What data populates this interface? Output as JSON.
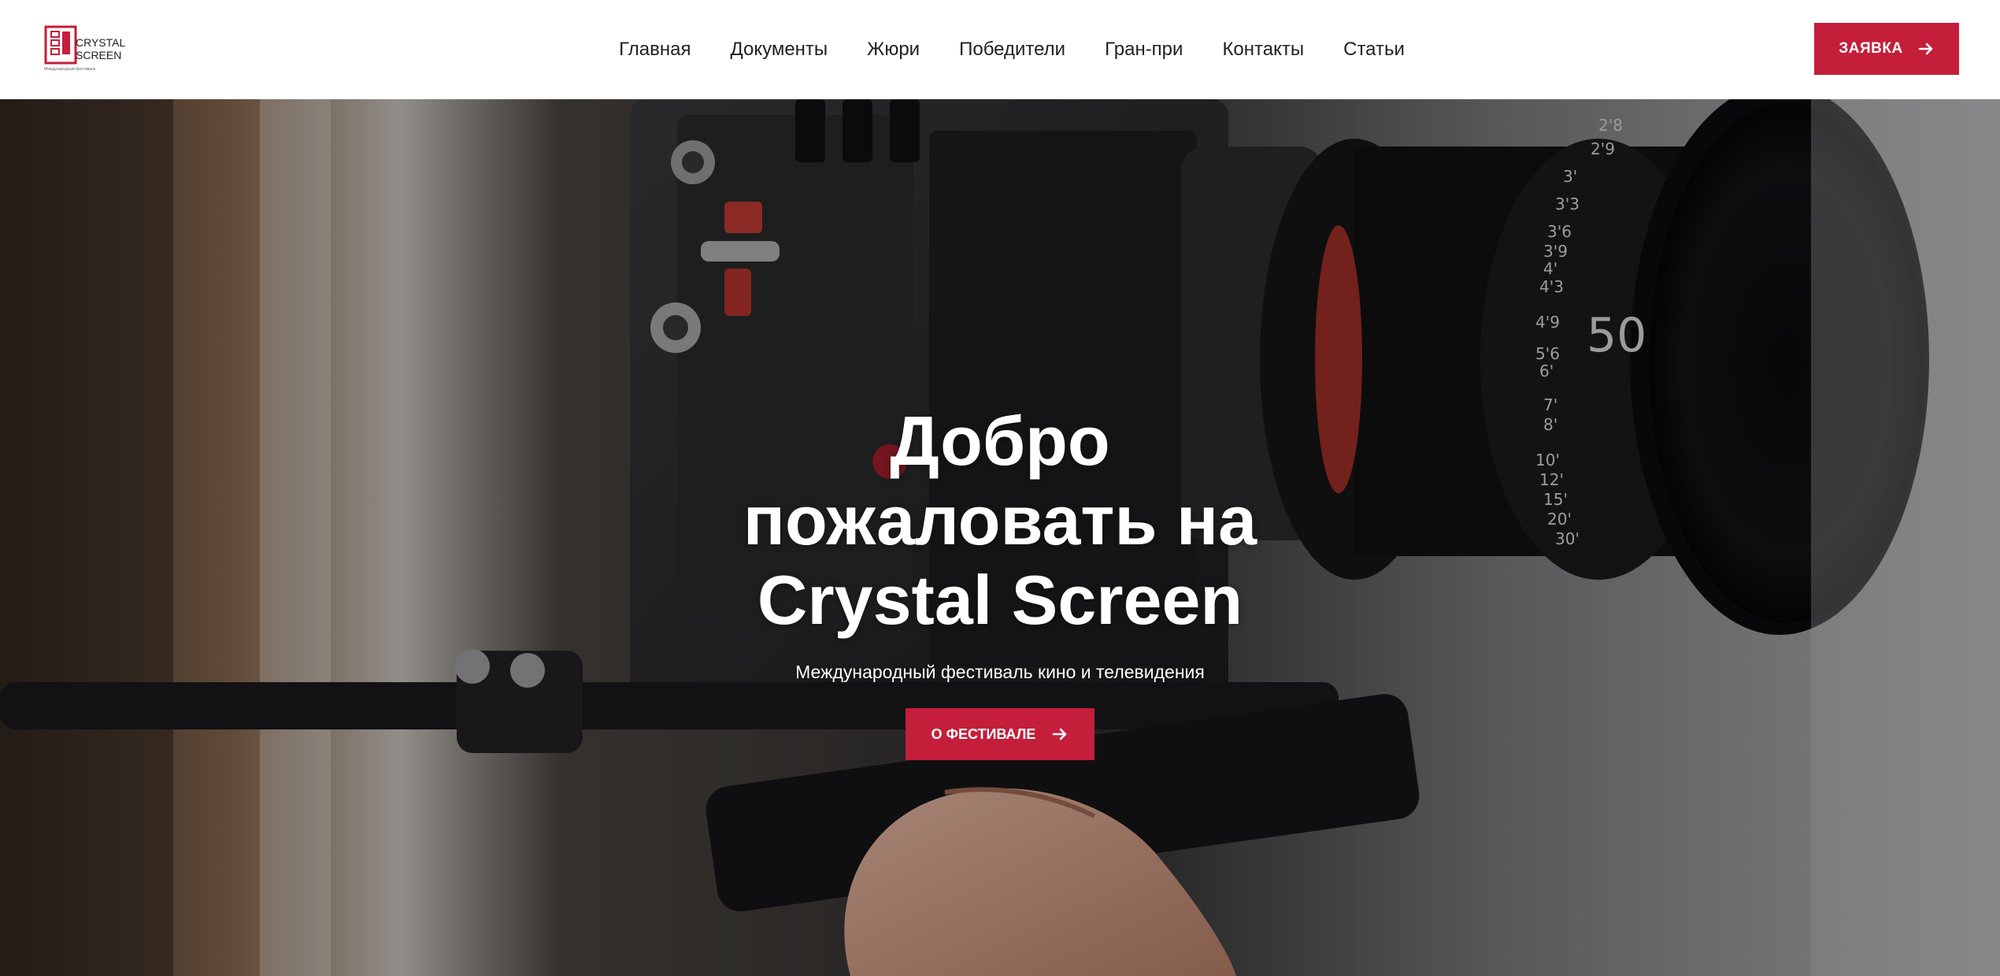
{
  "header": {
    "logo": {
      "line1": "CRYSTAL",
      "line2": "SCREEN",
      "tagline": "Международный фестиваль"
    },
    "nav": [
      {
        "label": "Главная"
      },
      {
        "label": "Документы"
      },
      {
        "label": "Жюри"
      },
      {
        "label": "Победители"
      },
      {
        "label": "Гран-при"
      },
      {
        "label": "Контакты"
      },
      {
        "label": "Статьи"
      }
    ],
    "cta_label": "ЗАЯВКА"
  },
  "hero": {
    "title": "Добро пожаловать на Crystal Screen",
    "subtitle": "Международный фестиваль кино и телевидения",
    "button_label": "О ФЕСТИВАЛЕ",
    "lens_focal": "50",
    "lens_scale": [
      "2'8",
      "2'9",
      "3'",
      "3'3",
      "3'6",
      "3'9",
      "4'",
      "4'3",
      "4'9",
      "5'6",
      "6'",
      "7'",
      "8'",
      "10'",
      "12'",
      "15'",
      "20'",
      "30'"
    ]
  },
  "colors": {
    "accent": "#c41e3a",
    "nav_text": "#222222",
    "hero_text": "#ffffff"
  },
  "icons": {
    "cta_arrow": "arrow-right-icon",
    "hero_arrow": "arrow-right-icon",
    "logo": "crystal-screen-logo"
  }
}
